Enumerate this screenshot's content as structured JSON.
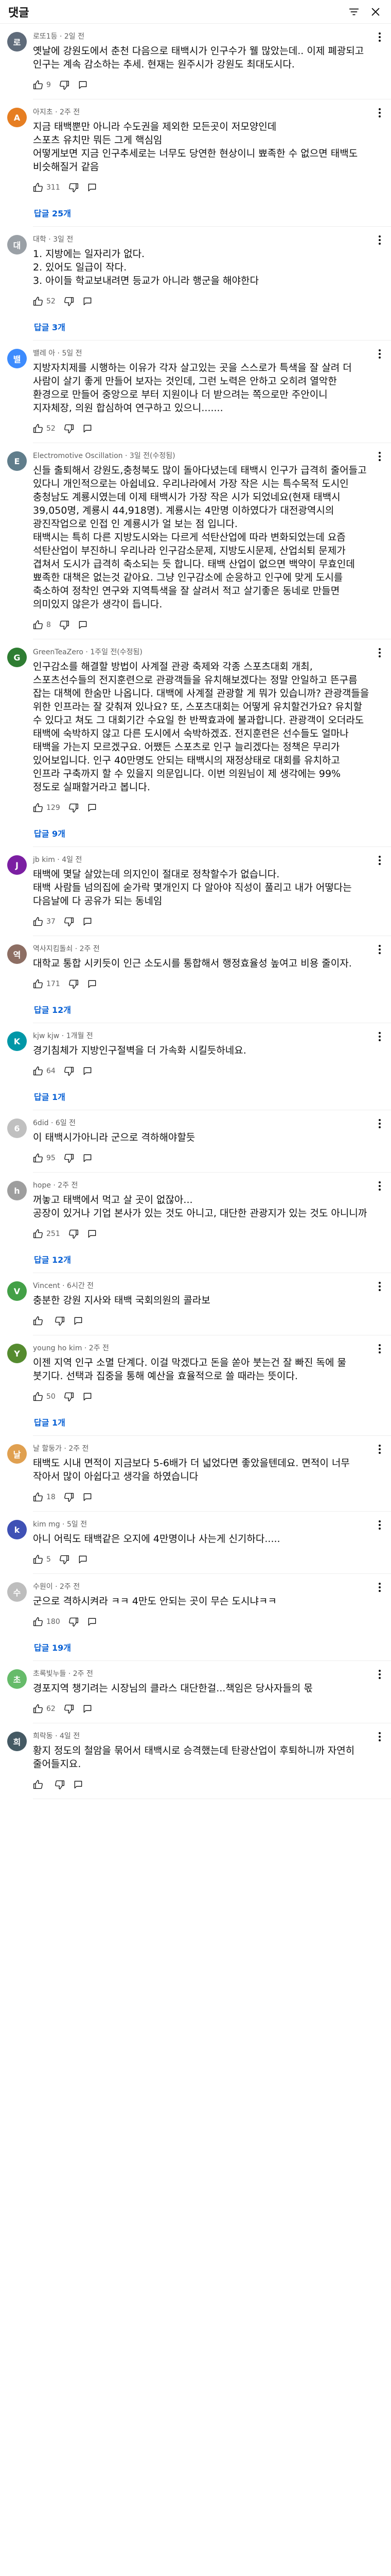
{
  "header": {
    "title": "댓글"
  },
  "labels": {
    "reply_icon": "comment-icon"
  },
  "comments": [
    {
      "author_meta": "로또1등 · 2일 전",
      "avatar_letter": "로",
      "avatar_color": "#5f6b7a",
      "text": "옛날에 강원도에서 춘천 다음으로 태백시가 인구수가 웰 많았는데.. 이제 폐광되고 인구는 계속 감소하는 추세. 현재는 원주시가 강원도 최대도시다.",
      "likes": "9",
      "replies": ""
    },
    {
      "author_meta": "아지초 · 2주 전",
      "avatar_letter": "A",
      "avatar_color": "#e67e22",
      "text": "지금 태백뿐만 아니라 수도권을 제외한 모든곳이 저모양인데\n스포츠 유치만 뭐든 그게 핵심임\n어떻게보면 지금 인구추세로는 너무도 당연한 현상이니 뾰족한 수 없으면 태백도 비슷해질거 같음",
      "likes": "311",
      "replies": "답글 25개"
    },
    {
      "author_meta": "대학 · 3일 전",
      "avatar_letter": "대",
      "avatar_color": "#9aa0a6",
      "text": "1. 지방에는 일자리가 없다.\n2. 있어도 일급이 작다.\n3. 아이들 학교보내려면 등교가 아니라 행군을 해야한다",
      "likes": "52",
      "replies": "답글 3개"
    },
    {
      "author_meta": "밸레 아 · 5일 전",
      "avatar_letter": "밸",
      "avatar_color": "#3d8bfd",
      "text": "지방자치제를 시행하는 이유가 각자 살고있는 곳을 스스로가 특색을 잘 살려 더 사람이 살기 좋게 만들어 보자는 것인데, 그런 노력은 안하고 오히려 열악한 환경으로 만들어 중앙으로 부터 지원이나 더 받으려는 쪽으로만 주안이니 지자체장, 의원 합심하여 연구하고 있으니.......",
      "likes": "52",
      "replies": ""
    },
    {
      "author_meta": "Electromotive Oscillation · 3일 전(수정됨)",
      "avatar_letter": "E",
      "avatar_color": "#607d8b",
      "text": "신들 출퇴해서 강원도,충청북도 많이 돌아다녔는데 태백시 인구가 급격히 줄어들고 있다니 개인적으로는 아쉽네요. 우리나라에서 가장 작은 시는 특수목적 도시인 충청남도 계룡시였는데 이제 태백시가 가장 작은 시가 되었네요(현재 태백시 39,050명, 계룡시 44,918명). 계룡시는 4만명 이하였다가 대전광역시의 광진작업으로 인접 인 계룡시가 얼 보는 점 입니다.\n태백시는 특히 다른 지방도시와는 다르게 석탄산업에 따라 변화되었는데 요즘 석탄산업이 부진하니 우리나라 인구감소문제, 지방도시문제, 산업쇠퇴 문제가 겹쳐서 도시가 급격히 축소되는 듯 합니다. 태백 산업이 없으면 백약이 무효인데 뾰족한 대책은 없는것 같아요. 그냥 인구감소에 순응하고 인구에 맞게 도시를 축소하여 정착인 연구와 지역특색을 잘 살려서 적고 살기좋은 동네로 만들면 의미있지 않은가 생각이 듭니다.",
      "likes": "8",
      "replies": ""
    },
    {
      "author_meta": "GreenTeaZero · 1주일 전(수정됨)",
      "avatar_letter": "G",
      "avatar_color": "#2e7d32",
      "text": "인구감소를 해결할 방법이 사계절 관광 축제와 각종 스포츠대회 개최, 스포츠선수들의 전지훈련으로 관광객들을 유치해보겠다는 정말 안일하고 뜬구름 잡는 대책에 한숨만 나옵니다. 대백에 사계절 관광할 게 뭐가 있습니까? 관광객들을 위한 인프라는 잘 갖춰져 있나요? 또, 스포츠대회는 어떻게 유치할건가요? 유치할 수 있다고 쳐도 그 대회기간 수요일 한 반짝효과에 불과합니다. 관광객이 오더라도 태백에 숙박하지 않고 다른 도시에서 숙박하겠죠. 전지훈련은 선수들도 얼마나 태백을 가는지 모르겠구요. 어쨌든 스포츠로 인구 늘리겠다는 정책은 무리가 있어보입니다. 인구 40만명도 안되는 태백시의 재정상태로 대회를 유치하고 인프라 구축까지 할 수 있을지 의문입니다. 이번 의원님이 제 생각에는 99% 정도로 실패할거라고 봅니다.",
      "likes": "129",
      "replies": "답글 9개"
    },
    {
      "author_meta": "jb kim · 4일 전",
      "avatar_letter": "J",
      "avatar_color": "#7b1fa2",
      "text": "태백에 몇달 살았는데 의지인이 절대로 정착할수가 없습니다.\n태백 사람들 넘의집에 숟가락 몇개인지 다 알아야 직성이 풀리고 내가 어떻다는 다음날에 다 공유가 되는 동네임",
      "likes": "37",
      "replies": ""
    },
    {
      "author_meta": "역사지킴돌쇠 · 2주 전",
      "avatar_letter": "역",
      "avatar_color": "#8d6e63",
      "text": "대학교 통합 시키듯이 인근 소도시를 통합해서 행정효율성 높여고 비용 줄이자.",
      "likes": "171",
      "replies": "답글 12개"
    },
    {
      "author_meta": "kjw kjw · 1개월 전",
      "avatar_letter": "K",
      "avatar_color": "#0097a7",
      "text": "경기침체가 지방인구절벽을 더 가속화 시킬듯하네요.",
      "likes": "64",
      "replies": "답글 1개"
    },
    {
      "author_meta": "6did · 6일 전",
      "avatar_letter": "6",
      "avatar_color": "#c0c0c0",
      "text": "이 태백시가아니라 군으로 격하해야할듯",
      "likes": "95",
      "replies": ""
    },
    {
      "author_meta": "hope · 2주 전",
      "avatar_letter": "h",
      "avatar_color": "#9e9e9e",
      "text": "꺼놓고 태백에서 먹고 살 곳이 없잖아...\n공장이 있거나 기업 본사가 있는 것도 아니고, 대단한 관광지가 있는 것도 아니니까",
      "likes": "251",
      "replies": "답글 12개"
    },
    {
      "author_meta": "Vincent · 6시간 전",
      "avatar_letter": "V",
      "avatar_color": "#43a047",
      "text": "충분한 강원 지사와 태백 국회의원의 콜라보",
      "likes": "",
      "replies": ""
    },
    {
      "author_meta": "young ho kim · 2주 전",
      "avatar_letter": "Y",
      "avatar_color": "#558b2f",
      "text": "이젠 지역 인구 소멸 단계다. 이걸 막겠다고 돈을 쏟아 붓는건 잘 빠진 독에 물 붓기다. 선택과 집중을 통해 예산을 효율적으로 쓸 때라는 뜻이다.",
      "likes": "50",
      "replies": "답글 1개"
    },
    {
      "author_meta": "날 할둥가 · 2주 전",
      "avatar_letter": "날",
      "avatar_color": "#e0a050",
      "text": "태백도 시내 면적이 지금보다 5-6배가 더 넓었다면 좋았을텐데요. 면적이 너무 작아서 많이 아쉽다고 생각을 하였습니다",
      "likes": "18",
      "replies": ""
    },
    {
      "author_meta": "kim mg · 5일 전",
      "avatar_letter": "k",
      "avatar_color": "#3f51b5",
      "text": "아니 어릭도 태백같은 오지에 4만명이나 사는게 신기하다.....",
      "likes": "5",
      "replies": ""
    },
    {
      "author_meta": "수원이 · 2주 전",
      "avatar_letter": "수",
      "avatar_color": "#bdbdbd",
      "text": "군으로 격하시켜라 ㅋㅋ 4만도 안되는 곳이 무슨 도시냐ㅋㅋ",
      "likes": "180",
      "replies": "답글 19개"
    },
    {
      "author_meta": "초록빛누들 · 2주 전",
      "avatar_letter": "초",
      "avatar_color": "#66bb6a",
      "text": "경포지역 챙기려는 시장님의 클라스 대단한걸...책임은 당사자들의 몫",
      "likes": "62",
      "replies": ""
    },
    {
      "author_meta": "희락동 · 4일 전",
      "avatar_letter": "희",
      "avatar_color": "#455a64",
      "text": "황지 정도의 철암을 묶어서 태백시로 승격했는데 탄광산업이 후퇴하니까 자연히 줄어들지요.",
      "likes": "",
      "replies": ""
    }
  ]
}
